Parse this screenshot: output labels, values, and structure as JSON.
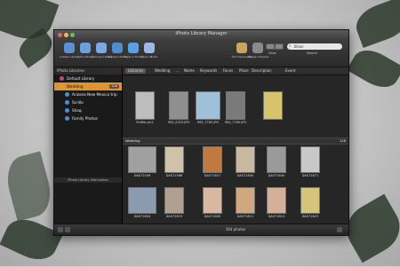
{
  "window": {
    "title": "iPhoto Library Manager",
    "traffic_colors": [
      "#ee5f5b",
      "#f5bd4f",
      "#61c454"
    ]
  },
  "toolbar": {
    "buttons": [
      {
        "label": "Create Library",
        "icon": "library-add-icon",
        "color": "#5b8fd6"
      },
      {
        "label": "Add Library",
        "icon": "library-plus-icon",
        "color": "#6a9fe0"
      },
      {
        "label": "Remove Library",
        "icon": "library-remove-icon",
        "color": "#7aa8e2"
      },
      {
        "label": "Rebuild Library",
        "icon": "rebuild-icon",
        "color": "#4a8fd0"
      },
      {
        "label": "Show in Finder",
        "icon": "finder-icon",
        "color": "#58a0e8"
      },
      {
        "label": "Open iPhoto",
        "icon": "iphoto-icon",
        "color": "#9ab8e0"
      },
      {
        "label": "Find Duplicates",
        "icon": "duplicates-icon",
        "color": "#c9a65a"
      },
      {
        "label": "Merge Libraries",
        "icon": "merge-icon",
        "color": "#8a8a8a"
      }
    ],
    "view_label": "View",
    "search_label": "Search",
    "search_value": "Brian"
  },
  "sidebar": {
    "header": "iPhoto Libraries",
    "items": [
      {
        "label": "Default Library",
        "color": "#c24a8a",
        "count": "",
        "selected": false
      },
      {
        "label": "Wedding",
        "color": "#e0a030",
        "count": "126",
        "selected": true
      },
      {
        "label": "Arizona New Mexico trip",
        "color": "#4b8fd8",
        "count": "",
        "selected": false
      },
      {
        "label": "Scrillo",
        "color": "#4b8fd8",
        "count": "",
        "selected": false
      },
      {
        "label": "Shaq",
        "color": "#4b8fd8",
        "count": "",
        "selected": false
      },
      {
        "label": "Family Photos",
        "color": "#4b8fd8",
        "count": "",
        "selected": false
      }
    ],
    "info_header": "iPhoto Library Information"
  },
  "tabs": [
    {
      "label": "Libraries",
      "active": true
    },
    {
      "label": "Wedding",
      "active": false
    },
    {
      "label": "...",
      "active": false
    },
    {
      "label": "Name",
      "active": false
    },
    {
      "label": "Keywords",
      "active": false
    },
    {
      "label": "Faces",
      "active": false
    },
    {
      "label": "Place",
      "active": false
    },
    {
      "label": "Description",
      "active": false
    },
    {
      "label": "Event",
      "active": false
    }
  ],
  "top_row": [
    {
      "label": "Profile pic1",
      "color": "#bdbdbd"
    },
    {
      "label": "IMG_0023.JPG",
      "color": "#8f8f8f"
    },
    {
      "label": "IMG_7765.JPG",
      "color": "#9ec0d8"
    },
    {
      "label": "IMG_7765.JPG",
      "color": "#7a7a7a"
    },
    {
      "label": "",
      "color": "#d6c36a"
    }
  ],
  "group": {
    "name": "Wedding",
    "count": "126"
  },
  "grid_rows": [
    [
      {
        "label": "DAS71556",
        "color": "#a0a0a0"
      },
      {
        "label": "DAS71568",
        "color": "#cfc2a8"
      },
      {
        "label": "DAS71627",
        "color": "#c07a40"
      },
      {
        "label": "DAS71600",
        "color": "#c9b8a0"
      },
      {
        "label": "DAS71640",
        "color": "#9a9a9a"
      },
      {
        "label": "DAS71671",
        "color": "#c8c8c8"
      }
    ],
    [
      {
        "label": "DAS71604",
        "color": "#8a9ab0"
      },
      {
        "label": "DAS71619",
        "color": "#b0a090"
      },
      {
        "label": "DAS71600",
        "color": "#d8b8a0"
      },
      {
        "label": "DAS71611",
        "color": "#d0a880"
      },
      {
        "label": "DAS71615",
        "color": "#d4b098"
      },
      {
        "label": "DAS71623",
        "color": "#d6c47a"
      }
    ],
    [
      {
        "label": "",
        "color": "#c8a890"
      },
      {
        "label": "",
        "color": "#a09080"
      },
      {
        "label": "",
        "color": "#c0b0a0"
      },
      {
        "label": "",
        "color": "#b09080"
      },
      {
        "label": "",
        "color": "#d0d0d0"
      },
      {
        "label": "",
        "color": "#c0a080"
      }
    ]
  ],
  "status": {
    "text": "184 photos"
  }
}
